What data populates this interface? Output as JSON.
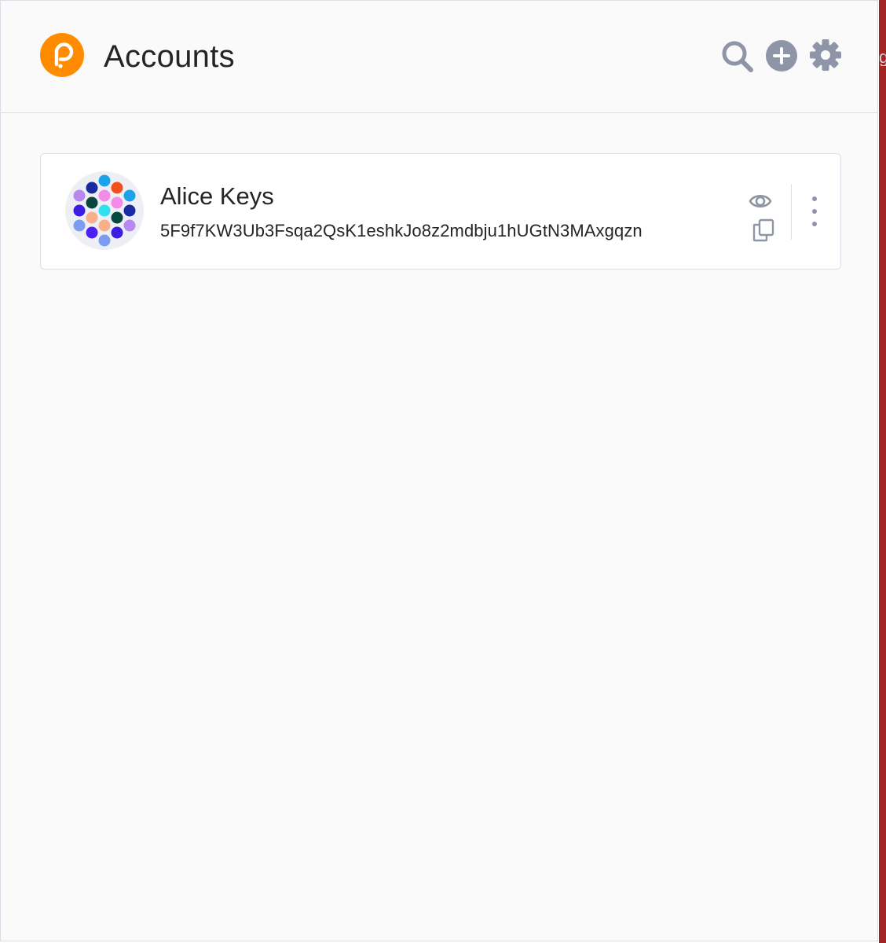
{
  "header": {
    "title": "Accounts",
    "logo_icon": "polkadot-logo-icon",
    "actions": [
      {
        "name": "search-icon",
        "label": "Search"
      },
      {
        "name": "add-account-icon",
        "label": "Add account"
      },
      {
        "name": "settings-gear-icon",
        "label": "Settings"
      }
    ]
  },
  "accounts": [
    {
      "name": "Alice Keys",
      "address": "5F9f7KW3Ub3Fsqa2QsK1eshkJo8z2mdbju1hUGtN3MAxgqzn",
      "avatar_icon": "identicon",
      "actions": [
        "eye-icon",
        "copy-icon",
        "more-options-icon"
      ]
    }
  ],
  "edge_glyph": "g",
  "colors": {
    "brand_orange": "#ff8c00",
    "icon_gray": "#8e95a6",
    "background": "#fafafa",
    "card_border": "#dcdde6",
    "text": "#242529",
    "edge_red": "#a32424"
  }
}
